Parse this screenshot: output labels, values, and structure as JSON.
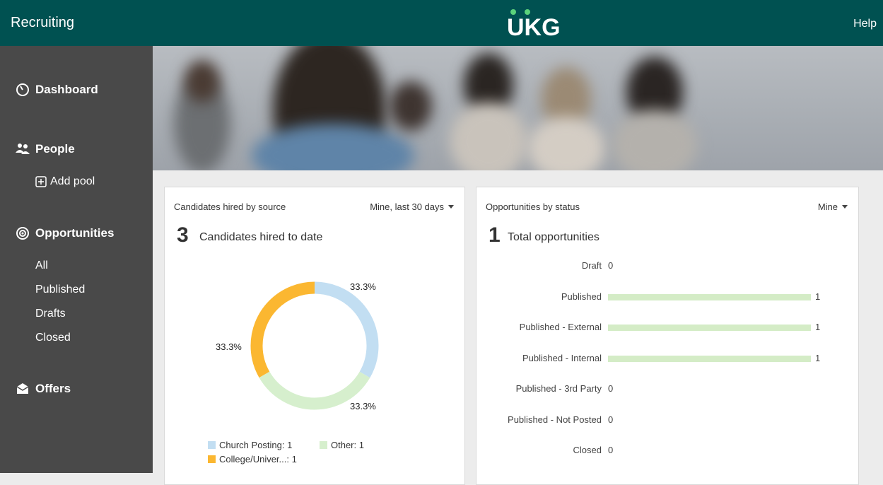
{
  "header": {
    "app_title": "Recruiting",
    "logo_text": "UKG",
    "help_label": "Help"
  },
  "sidebar": {
    "dashboard": {
      "label": "Dashboard",
      "icon": "dashboard-icon"
    },
    "people": {
      "label": "People",
      "icon": "people-icon"
    },
    "add_pool": {
      "label": "Add pool",
      "icon": "plus-square-icon"
    },
    "opportunities": {
      "label": "Opportunities",
      "icon": "target-icon"
    },
    "opportunity_items": [
      "All",
      "Published",
      "Drafts",
      "Closed"
    ],
    "offers": {
      "label": "Offers",
      "icon": "envelope-icon"
    }
  },
  "hired_card": {
    "title": "Candidates hired by source",
    "filter": "Mine, last 30 days",
    "count": "3",
    "count_label": "Candidates hired to date",
    "chart_data": {
      "type": "pie",
      "categories": [
        "Church Posting",
        "Other",
        "College/Univer..."
      ],
      "values": [
        1,
        1,
        1
      ],
      "percent_labels": [
        "33.3%",
        "33.3%",
        "33.3%"
      ],
      "colors": [
        "#c2def2",
        "#d6efcd",
        "#fbb731"
      ],
      "legend": [
        "Church Posting: 1",
        "Other: 1",
        "College/Univer...: 1"
      ]
    }
  },
  "opps_card": {
    "title": "Opportunities by status",
    "filter": "Mine",
    "count": "1",
    "count_label": "Total opportunities",
    "chart_data": {
      "type": "bar",
      "categories": [
        "Draft",
        "Published",
        "Published - External",
        "Published - Internal",
        "Published - 3rd Party",
        "Published - Not Posted",
        "Closed"
      ],
      "values": [
        0,
        1,
        1,
        1,
        0,
        0,
        0
      ],
      "xlim": [
        0,
        1
      ],
      "color": "#d4ecc6"
    }
  }
}
